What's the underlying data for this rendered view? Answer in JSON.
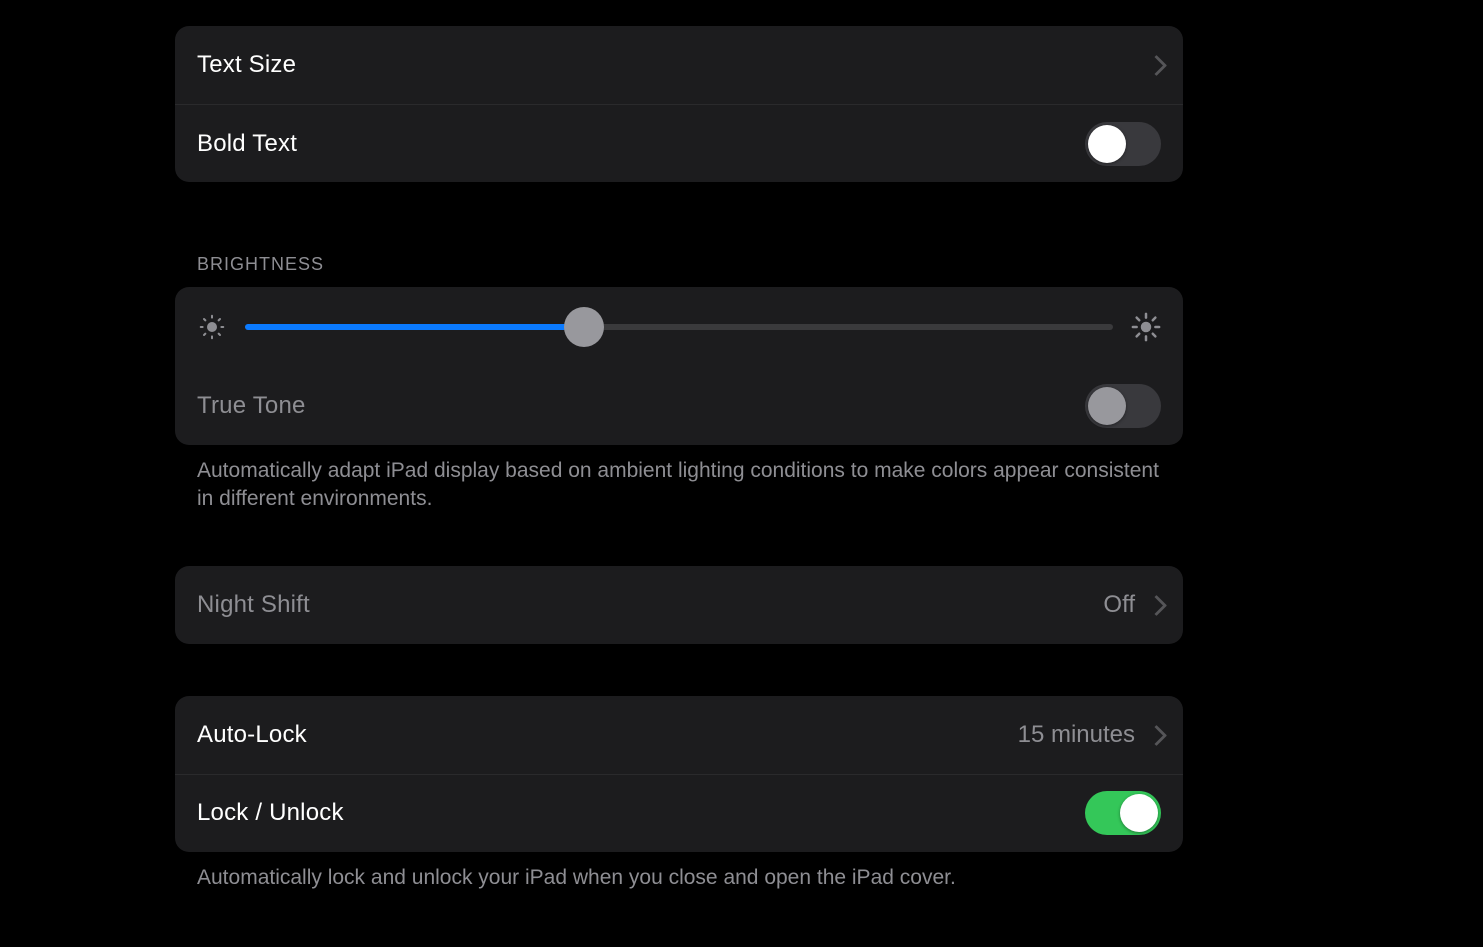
{
  "text_group": {
    "text_size_label": "Text Size",
    "bold_text_label": "Bold Text",
    "bold_text_on": false
  },
  "brightness_section": {
    "header": "BRIGHTNESS",
    "slider_percent": 39,
    "true_tone_label": "True Tone",
    "true_tone_on": false,
    "true_tone_footer": "Automatically adapt iPad display based on ambient lighting conditions to make colors appear consistent in different environments."
  },
  "night_shift": {
    "label": "Night Shift",
    "value": "Off"
  },
  "lock_section": {
    "auto_lock_label": "Auto-Lock",
    "auto_lock_value": "15 minutes",
    "lock_unlock_label": "Lock / Unlock",
    "lock_unlock_on": true,
    "lock_unlock_footer": "Automatically lock and unlock your iPad when you close and open the iPad cover."
  }
}
